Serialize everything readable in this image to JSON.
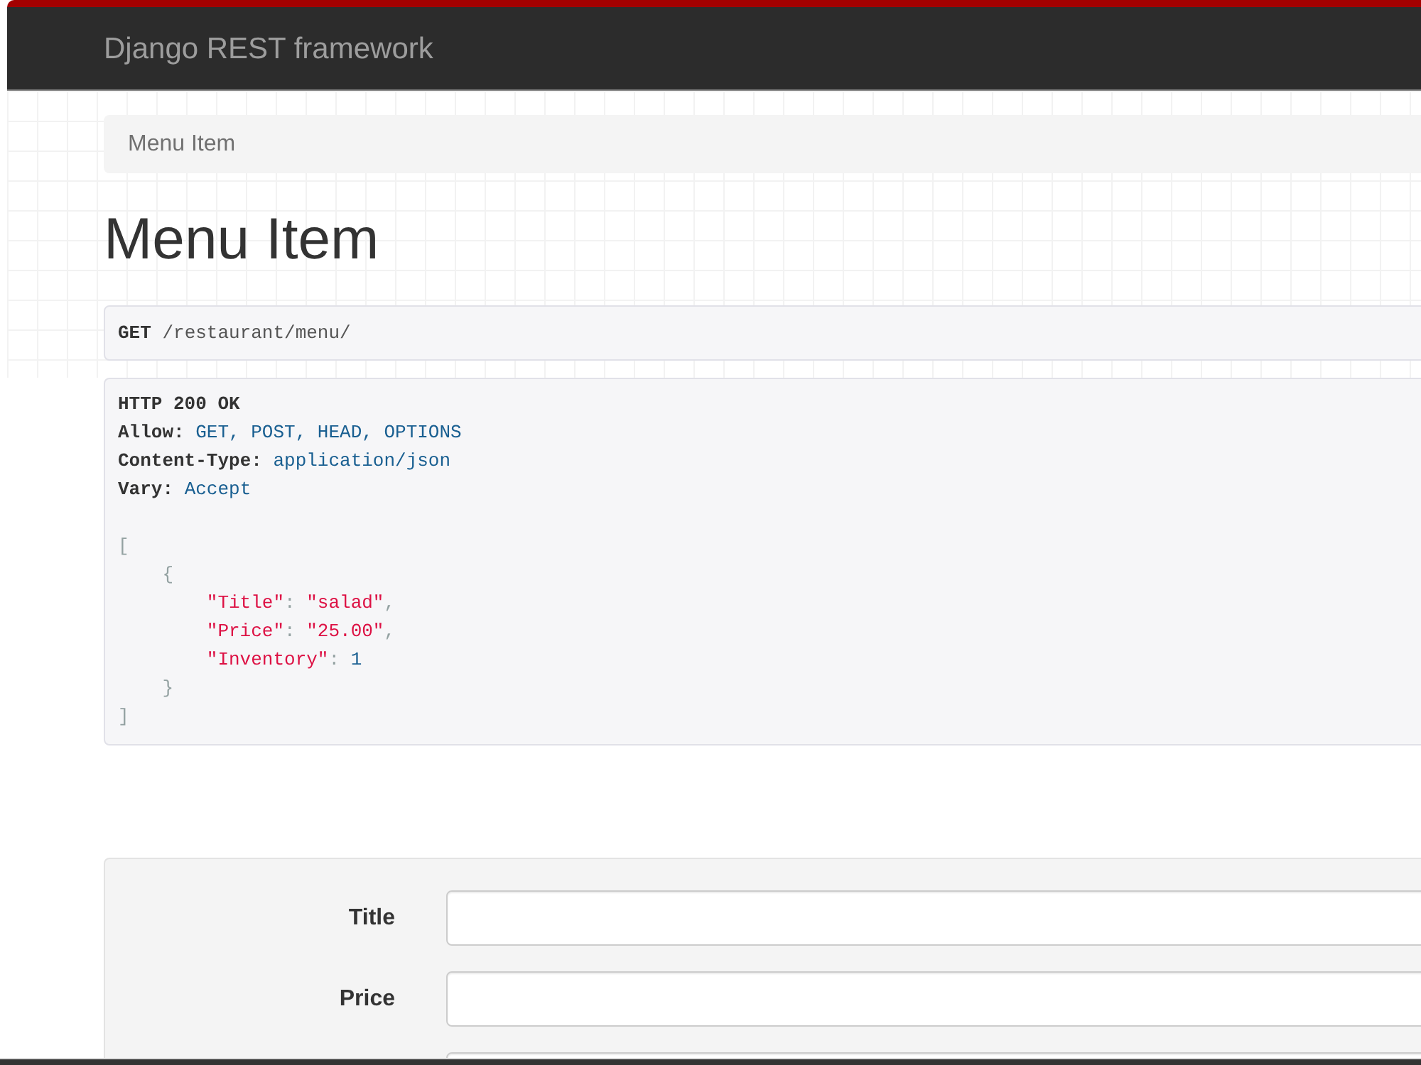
{
  "navbar": {
    "brand": "Django REST framework"
  },
  "breadcrumbs": [
    "Menu Item"
  ],
  "page_title": "Menu Item",
  "request": {
    "method": "GET",
    "path": "/restaurant/menu/"
  },
  "response": {
    "status": "HTTP 200 OK",
    "headers": [
      {
        "name": "Allow:",
        "value": "GET, POST, HEAD, OPTIONS"
      },
      {
        "name": "Content-Type:",
        "value": "application/json"
      },
      {
        "name": "Vary:",
        "value": "Accept"
      }
    ],
    "body": {
      "open": "[",
      "close": "]",
      "items": [
        {
          "open": "{",
          "close": "}",
          "members": [
            {
              "key": "\"Title\"",
              "colon": ":",
              "value": "\"salad\"",
              "kind": "string",
              "comma": ","
            },
            {
              "key": "\"Price\"",
              "colon": ":",
              "value": "\"25.00\"",
              "kind": "string",
              "comma": ","
            },
            {
              "key": "\"Inventory\"",
              "colon": ":",
              "value": "1",
              "kind": "number"
            }
          ]
        }
      ]
    }
  },
  "form": {
    "fields": [
      {
        "label": "Title",
        "kind": "text"
      },
      {
        "label": "Price",
        "kind": "text"
      },
      {
        "kind": "text"
      }
    ]
  }
}
